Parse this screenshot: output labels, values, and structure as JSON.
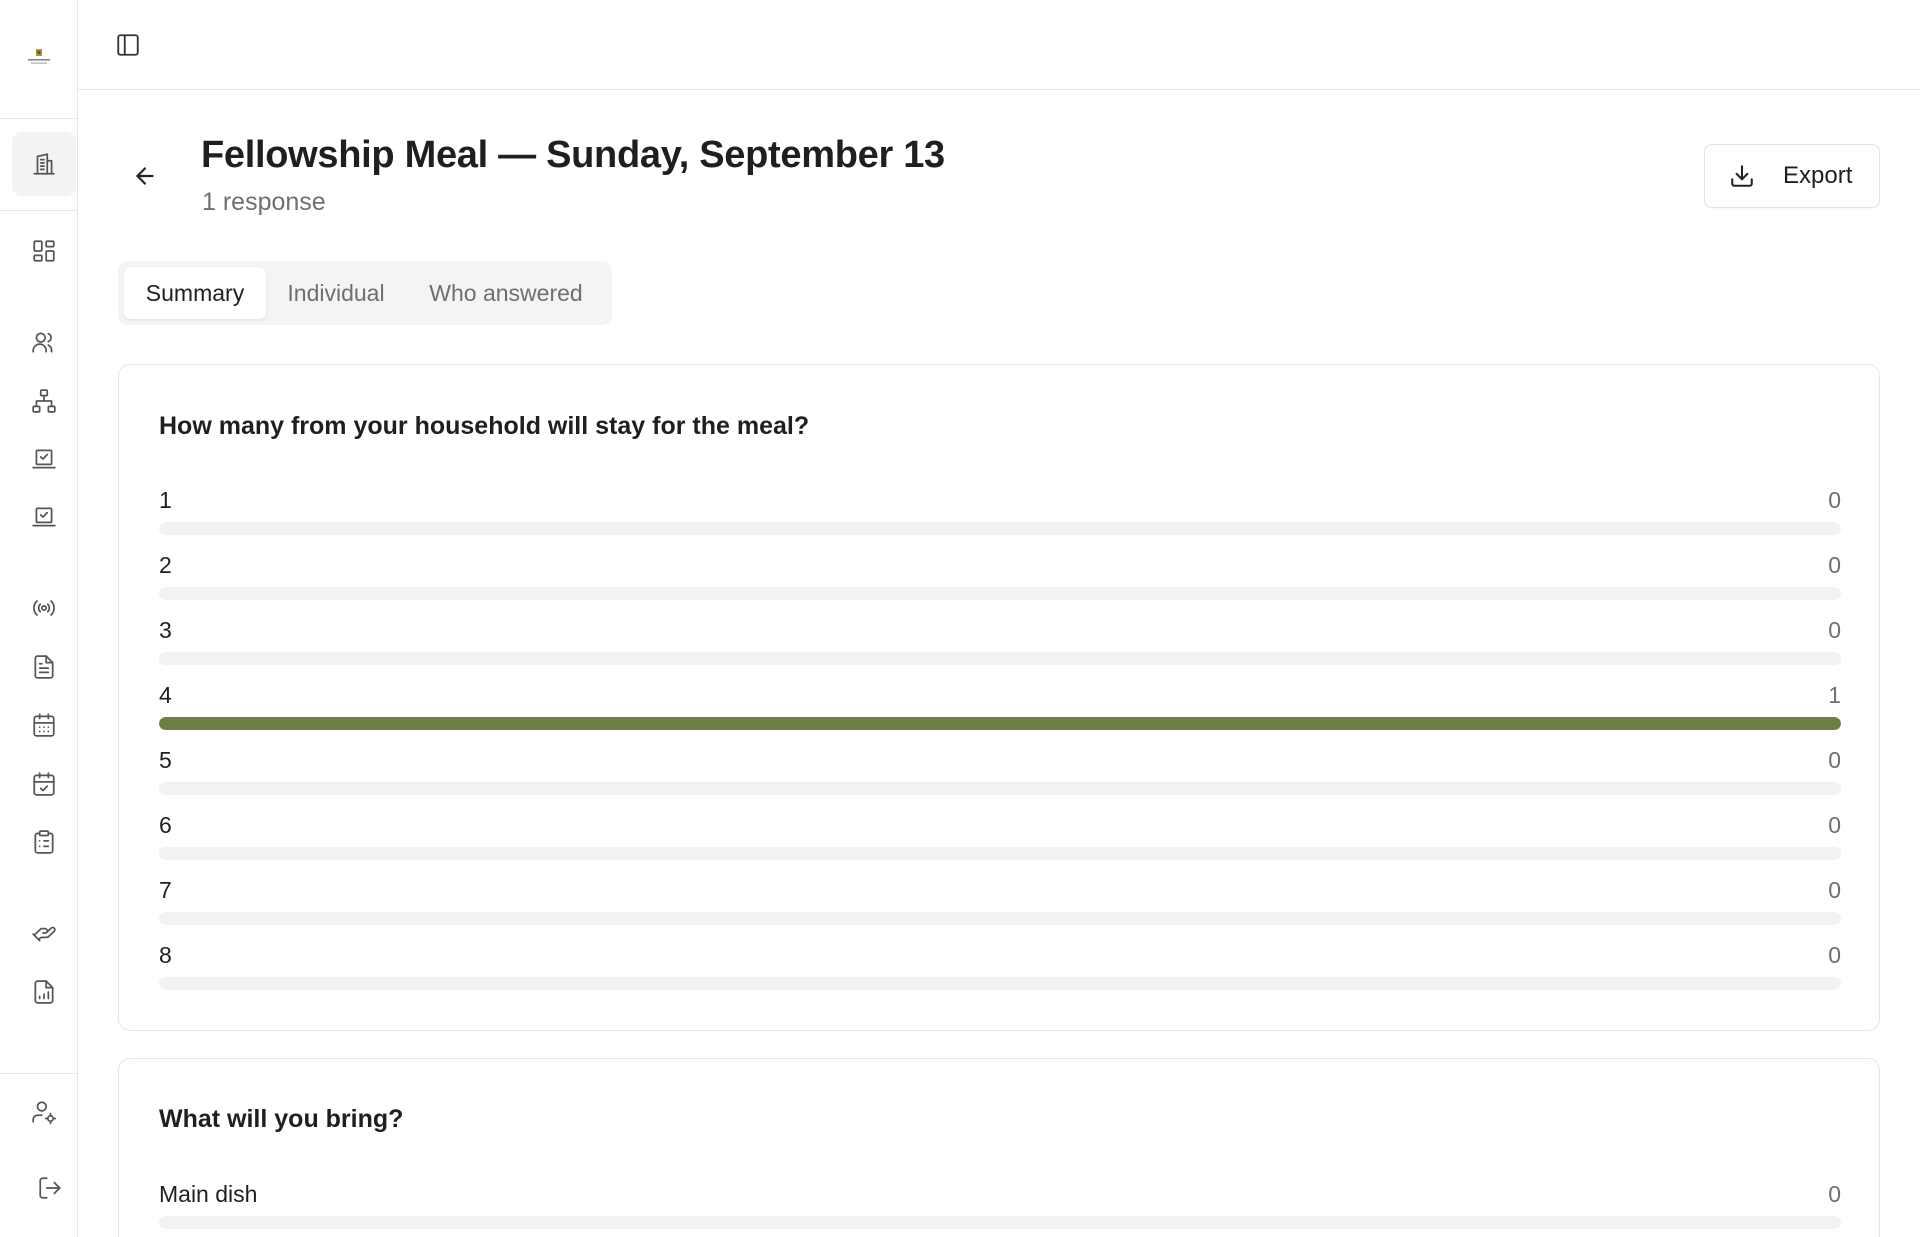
{
  "sidebar": {
    "logo": "church-logo",
    "items": [
      {
        "icon": "building-icon",
        "active": true
      },
      {
        "icon": "dashboard-icon"
      },
      {
        "icon": "users-icon"
      },
      {
        "icon": "org-chart-icon"
      },
      {
        "icon": "checkin-icon"
      },
      {
        "icon": "attendance-icon"
      },
      {
        "icon": "broadcast-icon"
      },
      {
        "icon": "document-icon"
      },
      {
        "icon": "calendar-icon"
      },
      {
        "icon": "calendar-check-icon"
      },
      {
        "icon": "clipboard-icon"
      },
      {
        "icon": "giving-icon"
      },
      {
        "icon": "report-icon"
      },
      {
        "icon": "user-settings-icon"
      },
      {
        "icon": "logout-icon"
      }
    ]
  },
  "header": {
    "title": "Fellowship Meal — Sunday, September 13",
    "subtitle": "1 response",
    "export_label": "Export"
  },
  "tabs": [
    {
      "label": "Summary",
      "active": true
    },
    {
      "label": "Individual",
      "active": false
    },
    {
      "label": "Who answered",
      "active": false
    }
  ],
  "questions": [
    {
      "title": "How many from your household will stay for the meal?",
      "options": [
        {
          "label": "1",
          "count": "0",
          "fraction": 0
        },
        {
          "label": "2",
          "count": "0",
          "fraction": 0
        },
        {
          "label": "3",
          "count": "0",
          "fraction": 0
        },
        {
          "label": "4",
          "count": "1",
          "fraction": 1
        },
        {
          "label": "5",
          "count": "0",
          "fraction": 0
        },
        {
          "label": "6",
          "count": "0",
          "fraction": 0
        },
        {
          "label": "7",
          "count": "0",
          "fraction": 0
        },
        {
          "label": "8",
          "count": "0",
          "fraction": 0
        }
      ]
    },
    {
      "title": "What will you bring?",
      "options": [
        {
          "label": "Main dish",
          "count": "0",
          "fraction": 0
        }
      ]
    }
  ],
  "colors": {
    "bar_fill": "#6e7f45",
    "bar_track": "#f2f2f2"
  }
}
